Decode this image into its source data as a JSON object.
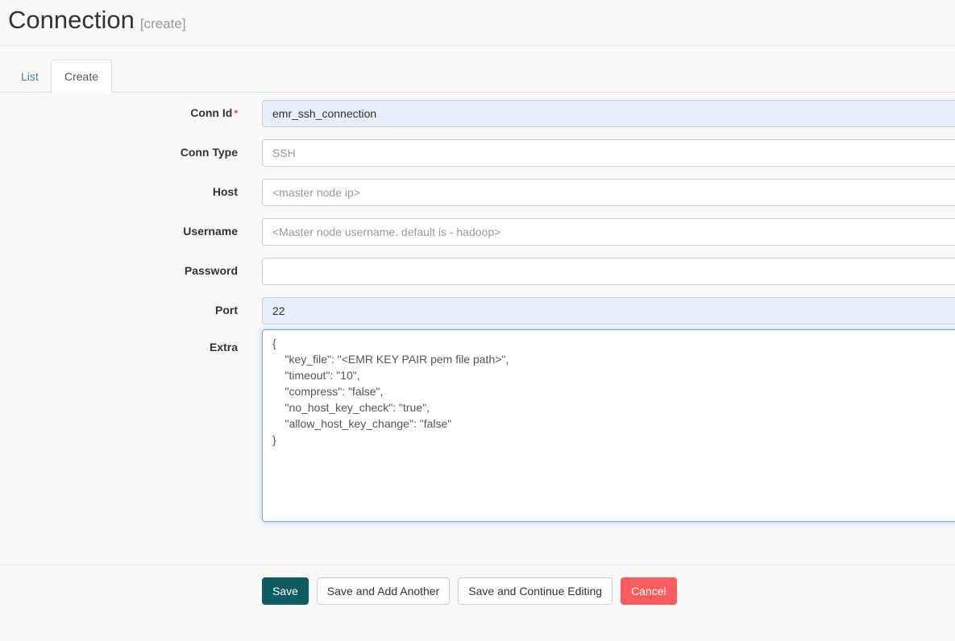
{
  "header": {
    "title": "Connection",
    "subtitle": "[create]"
  },
  "tabs": [
    {
      "label": "List",
      "active": false
    },
    {
      "label": "Create",
      "active": true
    }
  ],
  "form": {
    "fields": [
      {
        "label": "Conn Id",
        "required": true,
        "required_mark": "*",
        "value": "emr_ssh_connection",
        "placeholder": "",
        "state": "autofilled"
      },
      {
        "label": "Conn Type",
        "required": false,
        "required_mark": "",
        "value": "",
        "placeholder": "SSH",
        "state": "normal"
      },
      {
        "label": "Host",
        "required": false,
        "required_mark": "",
        "value": "",
        "placeholder": "<master node ip>",
        "state": "normal"
      },
      {
        "label": "Username",
        "required": false,
        "required_mark": "",
        "value": "",
        "placeholder": "<Master node username. default is - hadoop>",
        "state": "normal"
      },
      {
        "label": "Password",
        "required": false,
        "required_mark": "",
        "value": "",
        "placeholder": "",
        "state": "normal"
      },
      {
        "label": "Port",
        "required": false,
        "required_mark": "",
        "value": "22",
        "placeholder": "",
        "state": "autofilled"
      }
    ],
    "extra": {
      "label": "Extra",
      "value": "{\n    \"key_file\": \"<EMR KEY PAIR pem file path>\",\n    \"timeout\": \"10\",\n    \"compress\": \"false\",\n    \"no_host_key_check\": \"true\",\n    \"allow_host_key_change\": \"false\"\n}",
      "focused": true
    }
  },
  "buttons": {
    "save": "Save",
    "save_add_another": "Save and Add Another",
    "save_continue": "Save and Continue Editing",
    "cancel": "Cancel"
  },
  "colors": {
    "primary": "#0d5c63",
    "danger": "#fc5c5c",
    "link": "#39859e",
    "autofill_bg": "#e8eefb",
    "focus_border": "#66afe9",
    "required_star": "#e8453c",
    "page_bg": "#f9f9f9"
  }
}
